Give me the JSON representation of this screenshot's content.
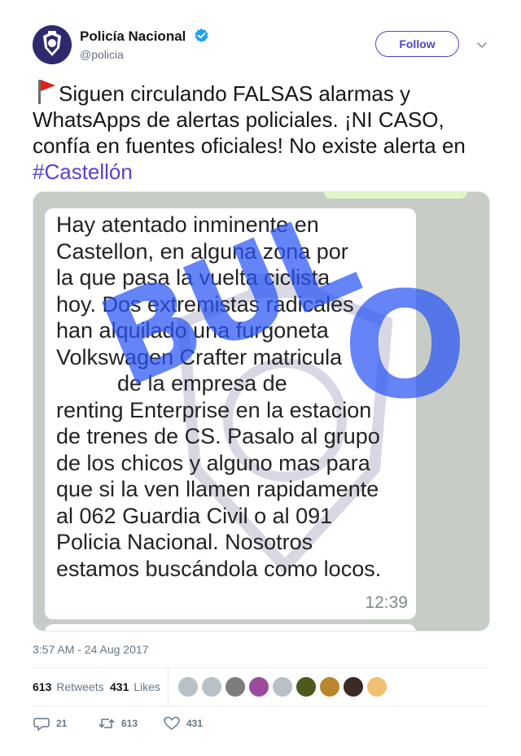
{
  "author": {
    "name": "Policía Nacional",
    "handle": "@policia",
    "follow_label": "Follow"
  },
  "tweet": {
    "text_main": "Siguen circulando FALSAS alarmas y WhatsApps de alertas policiales. ¡NI CASO, confía en fuentes oficiales! No existe alerta en ",
    "hashtag": "#Castellón",
    "emoji": "red-flag-icon"
  },
  "media": {
    "message_lines": [
      "Hay atentado inminente en",
      "Castellon, en alguna zona por",
      "la que pasa la vuelta ciclista",
      "hoy. Dos extremistas radicales",
      "han alquilado una furgoneta",
      "Volkswagen Crafter matricula",
      "          de la empresa de",
      "renting Enterprise en la estacion",
      "de trenes de CS. Pasalo al grupo",
      "de los chicos y alguno mas para",
      "que si la ven llamen rapidamente",
      "al 062 Guardia Civil o al 091",
      "Policia Nacional. Nosotros",
      "estamos buscándola como locos."
    ],
    "message_time": "12:39",
    "stamp_word": "BUL",
    "stamp_word_end": "O"
  },
  "timestamp": "3:57 AM - 24 Aug 2017",
  "stats": {
    "retweets_count": "613",
    "retweets_label": "Retweets",
    "likes_count": "431",
    "likes_label": "Likes"
  },
  "likers": [
    "avatar-1",
    "avatar-2",
    "avatar-3",
    "avatar-4",
    "avatar-5",
    "avatar-6",
    "avatar-7",
    "avatar-8",
    "avatar-9"
  ],
  "actions": {
    "reply_count": "21",
    "retweet_count": "613",
    "like_count": "431"
  },
  "colors": {
    "accent": "#4f46c8",
    "hashtag": "#5a3fd0",
    "verified": "#1da1f2",
    "stamp": "#2855f5"
  }
}
